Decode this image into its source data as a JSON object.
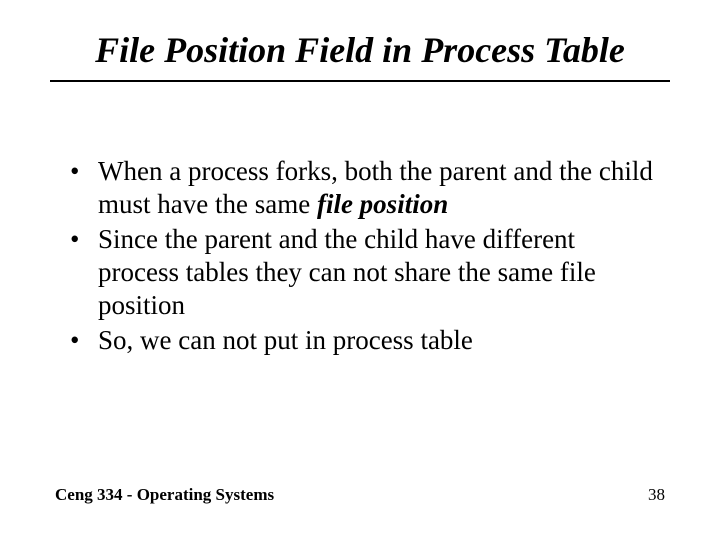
{
  "title": "File Position Field in Process Table",
  "bullets": [
    {
      "pre": "When a process forks, both the parent and the child must have the same ",
      "emph": "file position",
      "post": ""
    },
    {
      "pre": "Since the parent and the child have different process tables they can not share the same file position",
      "emph": "",
      "post": ""
    },
    {
      "pre": " So, we can not put in process table",
      "emph": "",
      "post": ""
    }
  ],
  "footer": {
    "left": "Ceng 334 - Operating Systems",
    "right": "38"
  }
}
